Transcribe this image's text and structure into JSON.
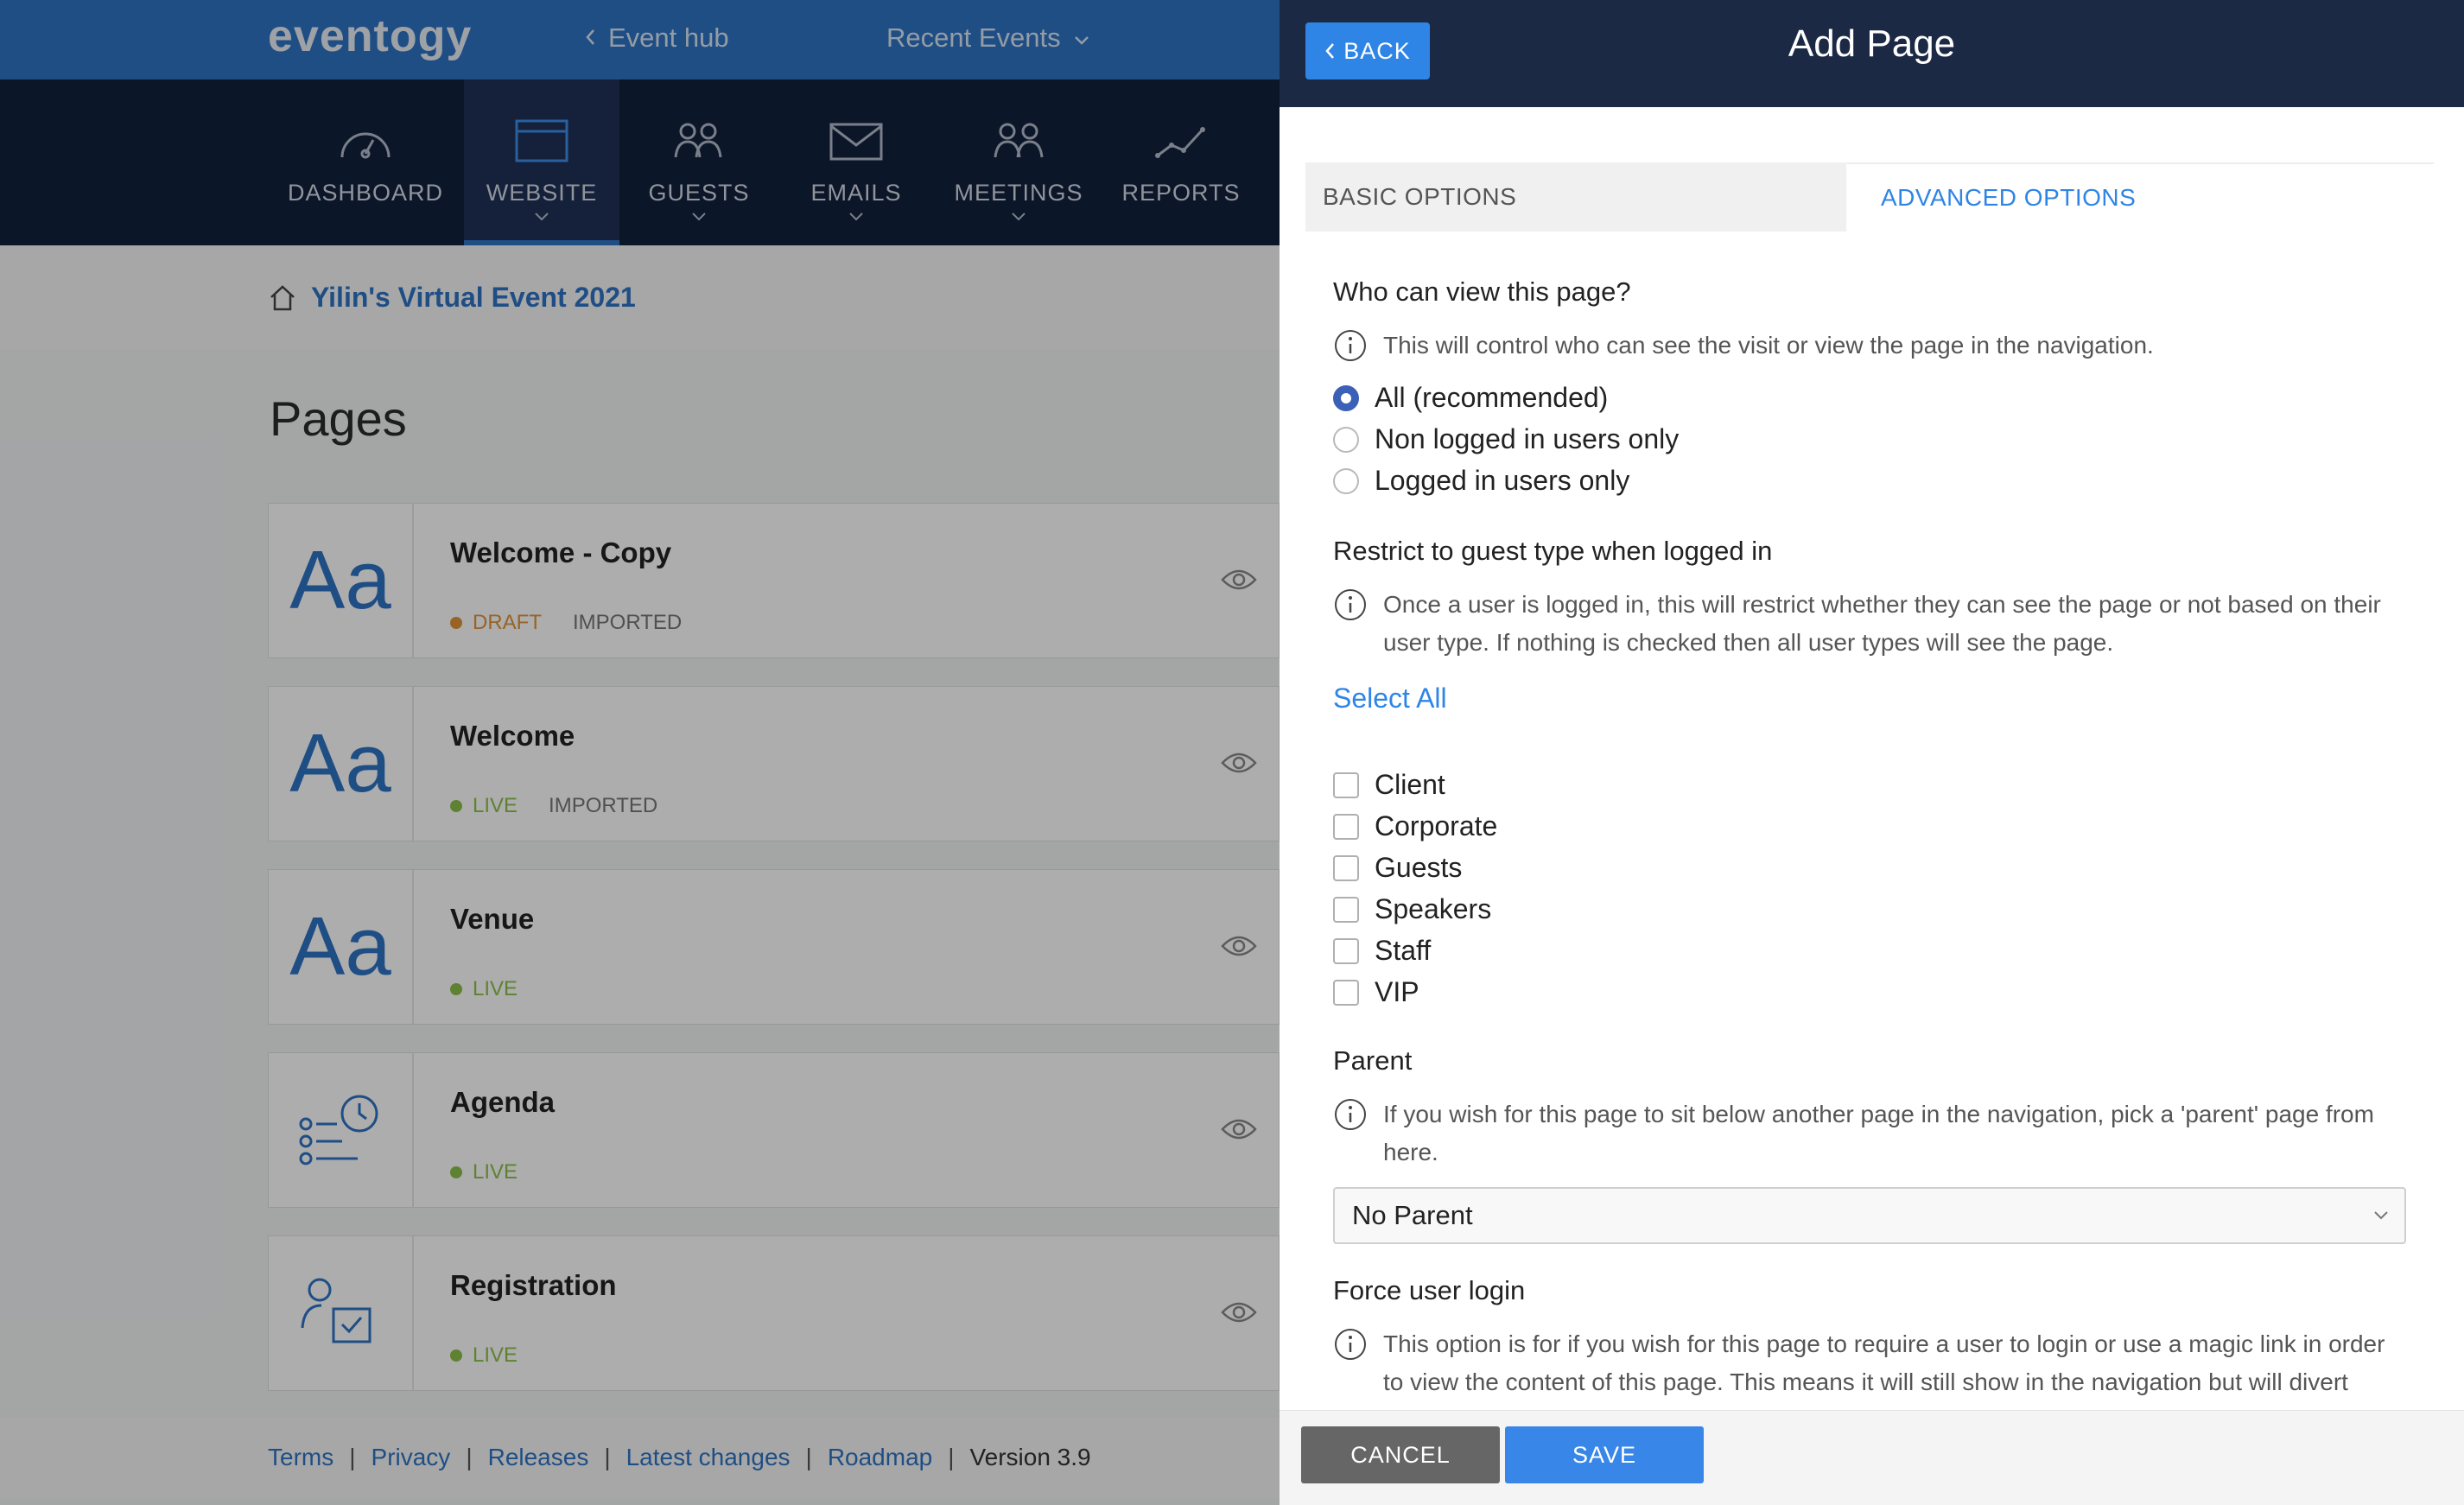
{
  "header": {
    "logo": "eventogy",
    "event_hub": "Event hub",
    "recent_events": "Recent Events"
  },
  "mainnav": [
    {
      "label": "DASHBOARD",
      "icon": "gauge-icon"
    },
    {
      "label": "WEBSITE",
      "icon": "browser-window-icon"
    },
    {
      "label": "GUESTS",
      "icon": "users-group-icon"
    },
    {
      "label": "EMAILS",
      "icon": "envelope-icon"
    },
    {
      "label": "MEETINGS",
      "icon": "people-pair-icon"
    },
    {
      "label": "REPORTS",
      "icon": "line-chart-icon"
    }
  ],
  "breadcrumb": {
    "event": "Yilin's Virtual Event 2021"
  },
  "pages": {
    "title": "Pages",
    "items": [
      {
        "title": "Welcome - Copy",
        "thumb": "Aa",
        "status": "DRAFT",
        "tag": "IMPORTED"
      },
      {
        "title": "Welcome",
        "thumb": "Aa",
        "status": "LIVE",
        "tag": "IMPORTED"
      },
      {
        "title": "Venue",
        "thumb": "Aa",
        "status": "LIVE",
        "tag": ""
      },
      {
        "title": "Agenda",
        "thumb": "",
        "status": "LIVE",
        "tag": ""
      },
      {
        "title": "Registration",
        "thumb": "",
        "status": "LIVE",
        "tag": ""
      }
    ]
  },
  "footer": {
    "links": [
      "Terms",
      "Privacy",
      "Releases",
      "Latest changes",
      "Roadmap"
    ],
    "version": "Version 3.9"
  },
  "panel": {
    "back": "BACK",
    "title": "Add Page",
    "tabs": {
      "basic": "BASIC OPTIONS",
      "advanced": "ADVANCED OPTIONS"
    },
    "who_can_view": {
      "heading": "Who can view this page?",
      "info": "This will control who can see the visit or view the page in the navigation.",
      "options": [
        "All (recommended)",
        "Non logged in users only",
        "Logged in users only"
      ]
    },
    "restrict": {
      "heading": "Restrict to guest type when logged in",
      "info_line1": "Once a user is logged in, this will restrict whether they can see the page or not based on their",
      "info_line2": "user type. If nothing is checked then all user types will see the page.",
      "select_all": "Select All",
      "types": [
        "Client",
        "Corporate",
        "Guests",
        "Speakers",
        "Staff",
        "VIP"
      ]
    },
    "parent": {
      "heading": "Parent",
      "info_line1": "If you wish for this page to sit below another page in the navigation, pick a 'parent' page from",
      "info_line2": "here.",
      "selected": "No Parent"
    },
    "force_login": {
      "heading": "Force user login",
      "info_line1": "This option is for if you wish for this page to require a user to login or use a magic link in order",
      "info_line2": "to view the content of this page. This means it will still show in the navigation but will divert"
    },
    "cancel": "CANCEL",
    "save": "SAVE"
  },
  "colors": {
    "brand_blue": "#2f73c4",
    "nav_dark": "#12213d",
    "draft": "#e0923a",
    "live": "#8cc04a",
    "panel_header": "#1c2945"
  }
}
